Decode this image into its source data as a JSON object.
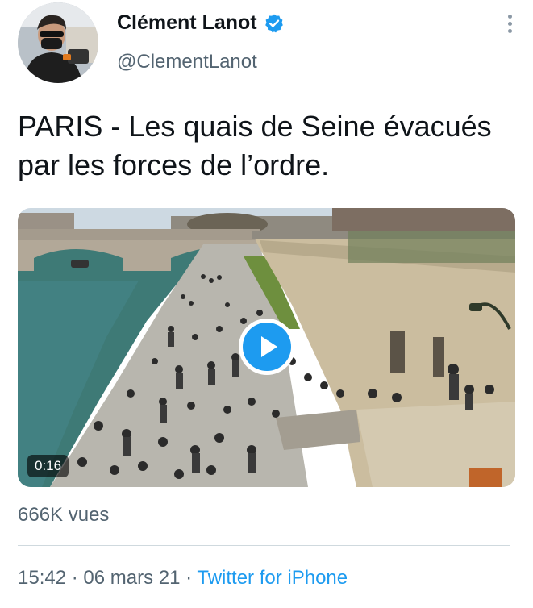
{
  "author": {
    "name": "Clément Lanot",
    "handle": "@ClementLanot",
    "verified": true,
    "avatar_icon": "user-avatar-photo"
  },
  "menu": {
    "icon": "more-vertical-icon"
  },
  "tweet": {
    "text": "PARIS - Les quais de Seine évacués par les forces de l’ordre."
  },
  "media": {
    "type": "video",
    "duration": "0:16",
    "play_icon": "play-icon"
  },
  "stats": {
    "views": "666K vues"
  },
  "meta": {
    "time": "15:42",
    "separator": " · ",
    "date": "06 mars 21",
    "source": "Twitter for iPhone"
  },
  "colors": {
    "accent": "#1d9bf0",
    "secondary_text": "#536471",
    "primary_text": "#0f1419",
    "divider": "#cfd9de"
  }
}
